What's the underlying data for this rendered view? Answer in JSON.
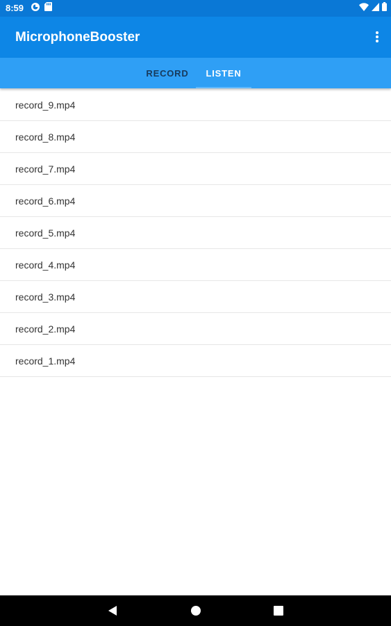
{
  "status_bar": {
    "time": "8:59",
    "left_icons": [
      "cast-icon",
      "sd-card-icon"
    ],
    "right_icons": [
      "wifi-icon",
      "signal-icon",
      "battery-icon"
    ]
  },
  "app_bar": {
    "title": "MicrophoneBooster",
    "overflow_icon": "more-vert-icon"
  },
  "tabs": [
    {
      "label": "RECORD",
      "selected": false
    },
    {
      "label": "LISTEN",
      "selected": true
    }
  ],
  "files": [
    "record_9.mp4",
    "record_8.mp4",
    "record_7.mp4",
    "record_6.mp4",
    "record_5.mp4",
    "record_4.mp4",
    "record_3.mp4",
    "record_2.mp4",
    "record_1.mp4"
  ],
  "nav_bar": {
    "buttons": [
      "back-icon",
      "home-icon",
      "recents-icon"
    ]
  },
  "colors": {
    "status_bar": "#0a78d6",
    "app_bar": "#0d86e6",
    "tab_bar": "#2f9ff5",
    "tab_selected_text": "#ffffff",
    "tab_unselected_text": "#173a5c",
    "list_text": "#333333",
    "divider": "#e6e6e6"
  }
}
